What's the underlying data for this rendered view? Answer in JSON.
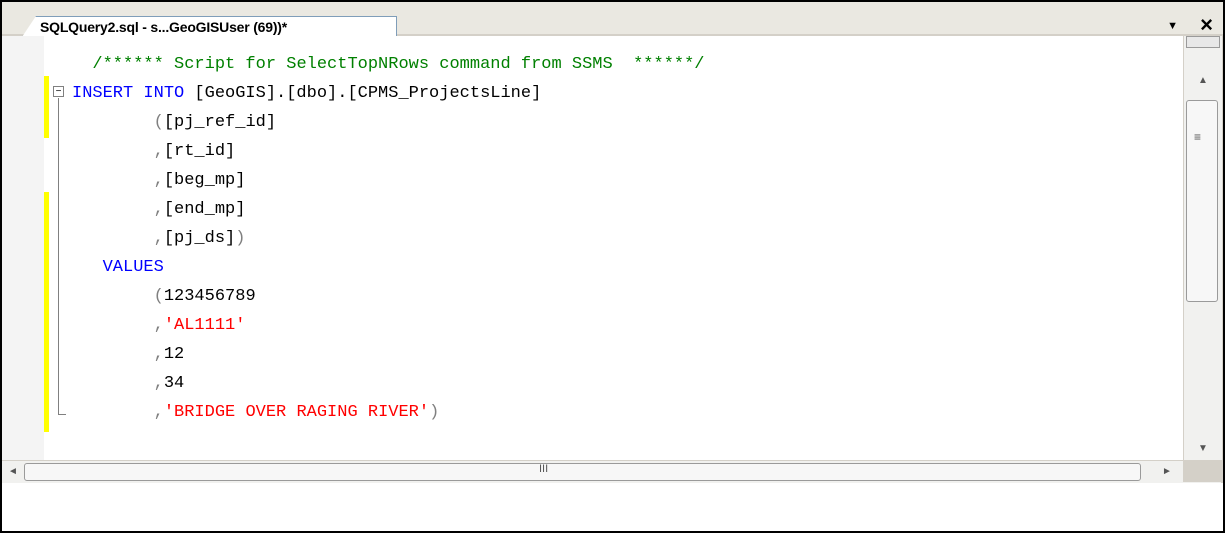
{
  "tab": {
    "title": "SQLQuery2.sql - s...GeoGISUser (69))*",
    "dropdown_icon": "chevron-down-icon",
    "close_icon": "close-icon"
  },
  "editor": {
    "lines": [
      {
        "indent": "  ",
        "parts": [
          {
            "t": "/****** Script for SelectTopNRows command from SSMS  ******/",
            "c": "cm"
          }
        ]
      },
      {
        "indent": "",
        "parts": [
          {
            "t": "INSERT INTO",
            "c": "kw"
          },
          {
            "t": " [GeoGIS].[dbo].[CPMS_ProjectsLine]",
            "c": ""
          }
        ]
      },
      {
        "indent": "        ",
        "parts": [
          {
            "t": "(",
            "c": "gry"
          },
          {
            "t": "[pj_ref_id]",
            "c": ""
          }
        ]
      },
      {
        "indent": "        ",
        "parts": [
          {
            "t": ",",
            "c": "gry"
          },
          {
            "t": "[rt_id]",
            "c": ""
          }
        ]
      },
      {
        "indent": "        ",
        "parts": [
          {
            "t": ",",
            "c": "gry"
          },
          {
            "t": "[beg_mp]",
            "c": ""
          }
        ]
      },
      {
        "indent": "        ",
        "parts": [
          {
            "t": ",",
            "c": "gry"
          },
          {
            "t": "[end_mp]",
            "c": ""
          }
        ]
      },
      {
        "indent": "        ",
        "parts": [
          {
            "t": ",",
            "c": "gry"
          },
          {
            "t": "[pj_ds]",
            "c": ""
          },
          {
            "t": ")",
            "c": "gry"
          }
        ]
      },
      {
        "indent": "   ",
        "parts": [
          {
            "t": "VALUES",
            "c": "kw"
          }
        ]
      },
      {
        "indent": "        ",
        "parts": [
          {
            "t": "(",
            "c": "gry"
          },
          {
            "t": "123456789",
            "c": ""
          }
        ]
      },
      {
        "indent": "        ",
        "parts": [
          {
            "t": ",",
            "c": "gry"
          },
          {
            "t": "'AL1111'",
            "c": "str"
          }
        ]
      },
      {
        "indent": "        ",
        "parts": [
          {
            "t": ",",
            "c": "gry"
          },
          {
            "t": "12",
            "c": ""
          }
        ]
      },
      {
        "indent": "        ",
        "parts": [
          {
            "t": ",",
            "c": "gry"
          },
          {
            "t": "34",
            "c": ""
          }
        ]
      },
      {
        "indent": "        ",
        "parts": [
          {
            "t": ",",
            "c": "gry"
          },
          {
            "t": "'BRIDGE OVER RAGING RIVER'",
            "c": "str"
          },
          {
            "t": ")",
            "c": "gry"
          }
        ]
      }
    ]
  },
  "colors": {
    "keyword": "#0000ff",
    "comment": "#008000",
    "string": "#ff0000",
    "change_marker": "#ffff00"
  },
  "scrollbars": {
    "vertical_grip": "≡",
    "horizontal_grip": "III"
  }
}
